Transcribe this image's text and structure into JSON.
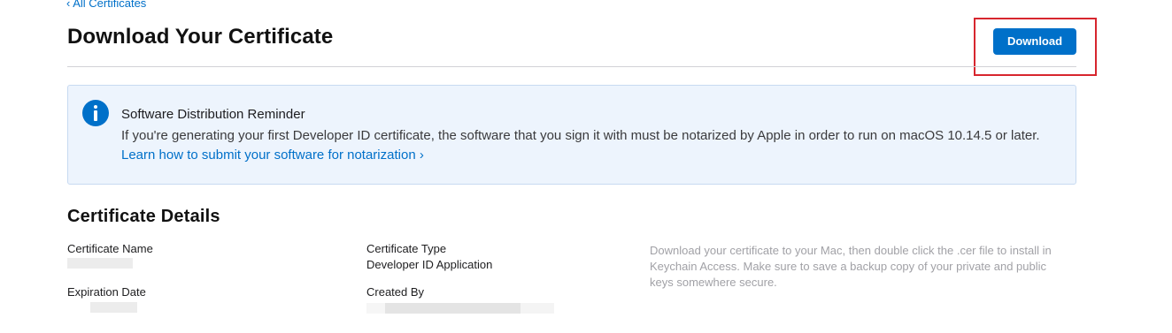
{
  "navigation": {
    "back_link": "‹ All Certificates"
  },
  "header": {
    "title": "Download Your Certificate",
    "download_button": "Download"
  },
  "reminder": {
    "icon": "info-icon",
    "title": "Software Distribution Reminder",
    "body": "If you're generating your first Developer ID certificate, the software that you sign it with must be notarized by Apple in order to run on macOS 10.14.5 or later. ",
    "link": "Learn how to submit your software for notarization ›"
  },
  "details": {
    "title": "Certificate Details",
    "certificate_name_label": "Certificate Name",
    "certificate_type_label": "Certificate Type",
    "certificate_type_value": "Developer ID Application",
    "expiration_date_label": "Expiration Date",
    "created_by_label": "Created By",
    "instructions": "Download your certificate to your Mac, then double click the .cer file to install in Keychain Access. Make sure to save a backup copy of your private and public keys somewhere secure."
  },
  "colors": {
    "accent": "#0070c9",
    "highlight": "#d7262e",
    "reminder_background": "#edf4fd"
  }
}
